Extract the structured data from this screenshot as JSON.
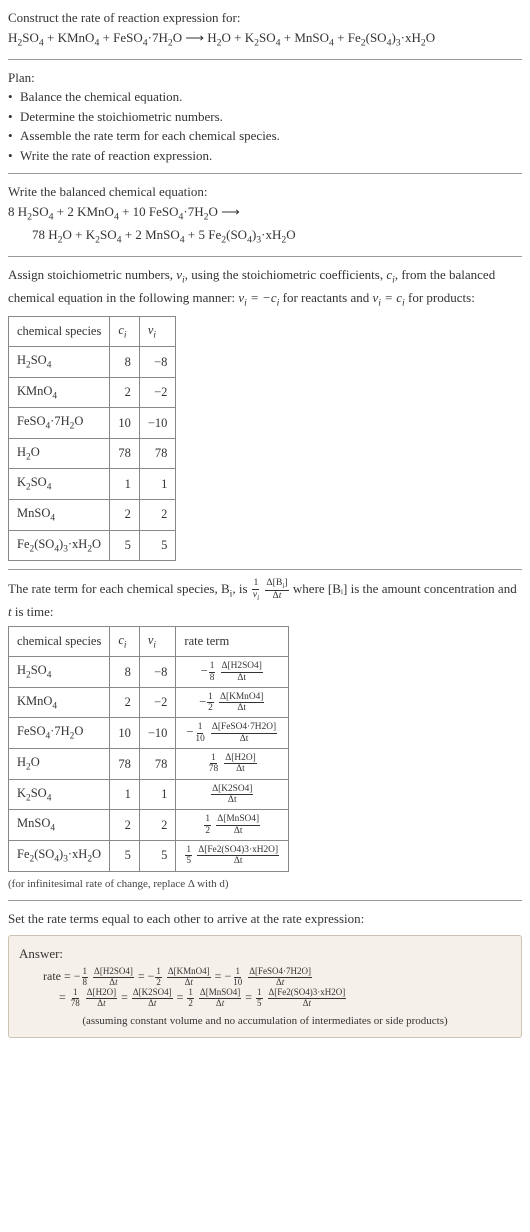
{
  "intro": {
    "prompt": "Construct the rate of reaction expression for:",
    "unbalanced_lhs": "H₂SO₄ + KMnO₄ + FeSO₄·7H₂O",
    "arrow": "⟶",
    "unbalanced_rhs": "H₂O + K₂SO₄ + MnSO₄ + Fe₂(SO₄)₃·xH₂O"
  },
  "plan": {
    "heading": "Plan:",
    "items": [
      "Balance the chemical equation.",
      "Determine the stoichiometric numbers.",
      "Assemble the rate term for each chemical species.",
      "Write the rate of reaction expression."
    ]
  },
  "balance": {
    "heading": "Write the balanced chemical equation:",
    "line1": "8 H₂SO₄ + 2 KMnO₄ + 10 FeSO₄·7H₂O ⟶",
    "line2": "78 H₂O + K₂SO₄ + 2 MnSO₄ + 5 Fe₂(SO₄)₃·xH₂O"
  },
  "assign": {
    "text1": "Assign stoichiometric numbers, ",
    "nu": "νᵢ",
    "text2": ", using the stoichiometric coefficients, ",
    "ci": "cᵢ",
    "text3": ", from the balanced chemical equation in the following manner: ",
    "rel1": "νᵢ = −cᵢ",
    "text4": " for reactants and ",
    "rel2": "νᵢ = cᵢ",
    "text5": " for products:"
  },
  "table1": {
    "headers": [
      "chemical species",
      "cᵢ",
      "νᵢ"
    ],
    "rows": [
      {
        "sp": "H₂SO₄",
        "c": "8",
        "v": "−8"
      },
      {
        "sp": "KMnO₄",
        "c": "2",
        "v": "−2"
      },
      {
        "sp": "FeSO₄·7H₂O",
        "c": "10",
        "v": "−10"
      },
      {
        "sp": "H₂O",
        "c": "78",
        "v": "78"
      },
      {
        "sp": "K₂SO₄",
        "c": "1",
        "v": "1"
      },
      {
        "sp": "MnSO₄",
        "c": "2",
        "v": "2"
      },
      {
        "sp": "Fe₂(SO₄)₃·xH₂O",
        "c": "5",
        "v": "5"
      }
    ]
  },
  "rateterm": {
    "text1": "The rate term for each chemical species, B",
    "sub_i": "i",
    "text2": ", is ",
    "text3": " where [Bᵢ] is the amount concentration and ",
    "tvar": "t",
    "text4": " is time:"
  },
  "table2": {
    "headers": [
      "chemical species",
      "cᵢ",
      "νᵢ",
      "rate term"
    ],
    "rows": [
      {
        "sp": "H₂SO₄",
        "c": "8",
        "v": "−8",
        "sign": "−",
        "fn": "1",
        "fd": "8",
        "dn": "Δ[H2SO4]",
        "dd": "Δt"
      },
      {
        "sp": "KMnO₄",
        "c": "2",
        "v": "−2",
        "sign": "−",
        "fn": "1",
        "fd": "2",
        "dn": "Δ[KMnO4]",
        "dd": "Δt"
      },
      {
        "sp": "FeSO₄·7H₂O",
        "c": "10",
        "v": "−10",
        "sign": "−",
        "fn": "1",
        "fd": "10",
        "dn": "Δ[FeSO4·7H2O]",
        "dd": "Δt"
      },
      {
        "sp": "H₂O",
        "c": "78",
        "v": "78",
        "sign": "",
        "fn": "1",
        "fd": "78",
        "dn": "Δ[H2O]",
        "dd": "Δt"
      },
      {
        "sp": "K₂SO₄",
        "c": "1",
        "v": "1",
        "sign": "",
        "fn": "",
        "fd": "",
        "dn": "Δ[K2SO4]",
        "dd": "Δt"
      },
      {
        "sp": "MnSO₄",
        "c": "2",
        "v": "2",
        "sign": "",
        "fn": "1",
        "fd": "2",
        "dn": "Δ[MnSO4]",
        "dd": "Δt"
      },
      {
        "sp": "Fe₂(SO₄)₃·xH₂O",
        "c": "5",
        "v": "5",
        "sign": "",
        "fn": "1",
        "fd": "5",
        "dn": "Δ[Fe2(SO4)3·xH2O]",
        "dd": "Δt"
      }
    ],
    "note": "(for infinitesimal rate of change, replace Δ with d)"
  },
  "final": {
    "heading": "Set the rate terms equal to each other to arrive at the rate expression:",
    "answer_label": "Answer:",
    "note": "(assuming constant volume and no accumulation of intermediates or side products)"
  }
}
